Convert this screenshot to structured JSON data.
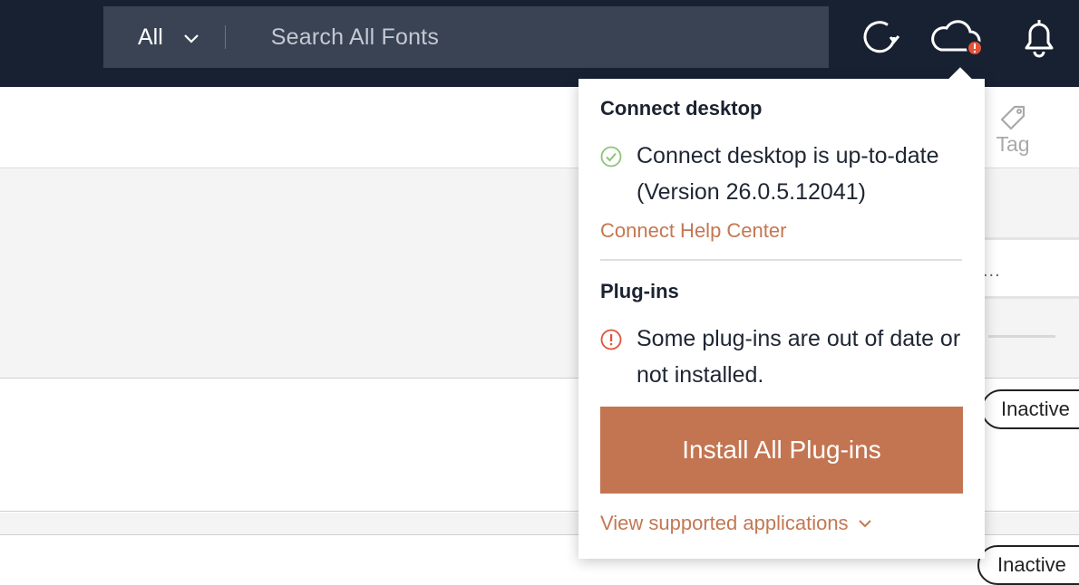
{
  "header": {
    "scope_label": "All",
    "search_placeholder": "Search All Fonts",
    "icons": [
      "sync-icon",
      "cloud-alert-icon",
      "bell-icon"
    ],
    "bg_color": "#182132",
    "search_bg_color": "#3a4354"
  },
  "toolbar": {
    "tag_label": "Tag"
  },
  "list": {
    "more_label": "...",
    "status_1": "Inactive",
    "status_2": "Inactive"
  },
  "popover": {
    "desktop_heading": "Connect desktop",
    "desktop_status": "Connect desktop is up-to-date (Version 26.0.5.12041)",
    "help_link": "Connect Help Center",
    "plugins_heading": "Plug-ins",
    "plugins_status": "Some plug-ins are out of date or not installed.",
    "install_button": "Install All Plug-ins",
    "view_apps_link": "View supported applications",
    "accent_color": "#c37551",
    "ok_color": "#8cc47a",
    "alert_color": "#e0533a"
  }
}
